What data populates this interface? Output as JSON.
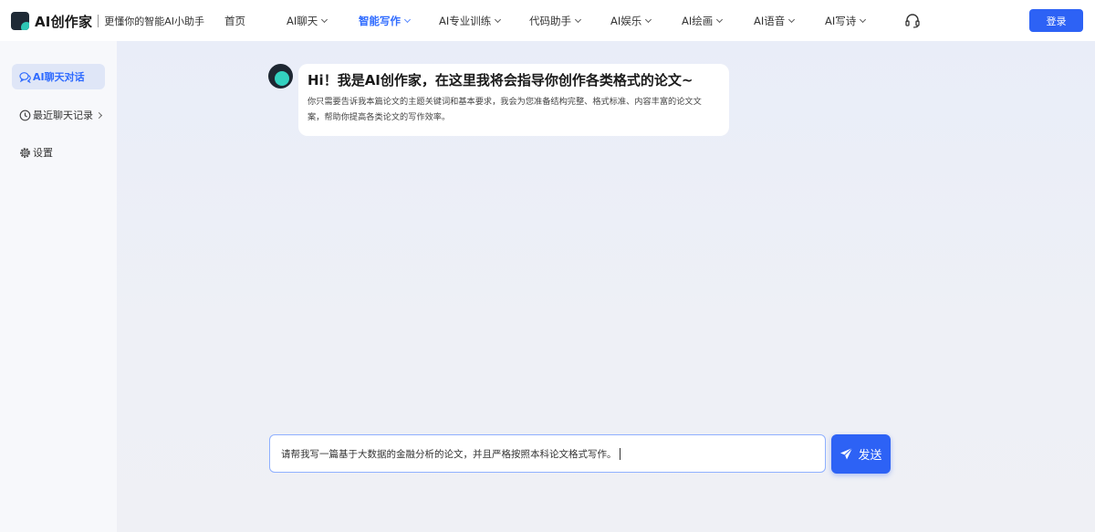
{
  "brand": {
    "name": "AI创作家",
    "slogan": "更懂你的智能AI小助手"
  },
  "nav": {
    "items": [
      {
        "label": "首页",
        "has_dropdown": false,
        "active": false
      },
      {
        "label": "AI聊天",
        "has_dropdown": true,
        "active": false
      },
      {
        "label": "智能写作",
        "has_dropdown": true,
        "active": true
      },
      {
        "label": "AI专业训练",
        "has_dropdown": true,
        "active": false
      },
      {
        "label": "代码助手",
        "has_dropdown": true,
        "active": false
      },
      {
        "label": "AI娱乐",
        "has_dropdown": true,
        "active": false
      },
      {
        "label": "AI绘画",
        "has_dropdown": true,
        "active": false
      },
      {
        "label": "AI语音",
        "has_dropdown": true,
        "active": false
      },
      {
        "label": "AI写诗",
        "has_dropdown": true,
        "active": false
      }
    ],
    "support_icon": "headset-icon",
    "login_label": "登录"
  },
  "sidebar": {
    "items": [
      {
        "label": "AI聊天对话",
        "icon": "chat-icon",
        "active": true
      },
      {
        "label": "最近聊天记录",
        "icon": "clock-icon",
        "active": false
      },
      {
        "label": "设置",
        "icon": "gear-icon",
        "active": false
      }
    ]
  },
  "chat": {
    "greeting_title": "Hi！我是AI创作家，在这里我将会指导你创作各类格式的论文~",
    "greeting_text": "你只需要告诉我本篇论文的主题关键词和基本要求，我会为您准备结构完整、格式标准、内容丰富的论文文案，帮助你提高各类论文的写作效率。"
  },
  "composer": {
    "input_value": "请帮我写一篇基于大数据的金融分析的论文，并且严格按照本科论文格式写作。",
    "send_label": "发送"
  },
  "colors": {
    "accent": "#2d62f5",
    "active_nav": "#2f6bff",
    "brand_teal": "#2ec7b5"
  }
}
